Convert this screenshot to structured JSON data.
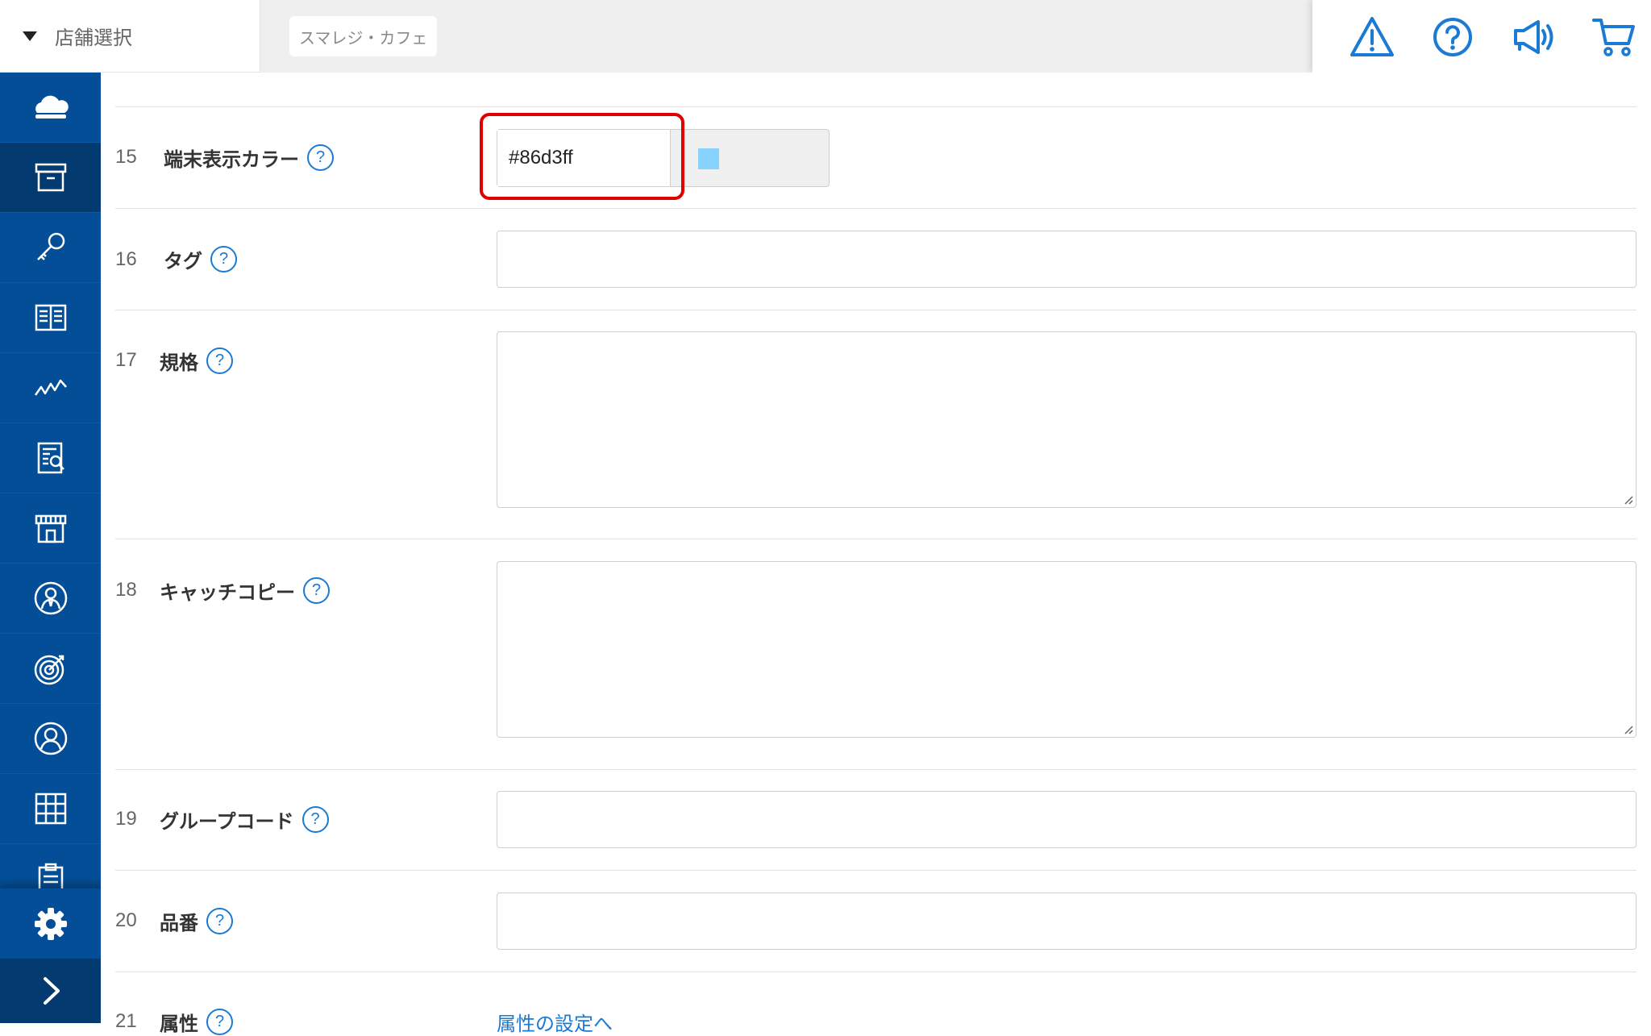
{
  "header": {
    "store_select_label": "店舗選択",
    "store_chip": "スマレジ・カフェ",
    "icons": [
      "warning-icon",
      "help-icon",
      "announcement-icon",
      "cart-icon"
    ]
  },
  "sidebar": {
    "items": [
      "cloud-icon",
      "archive-box-icon",
      "key-icon",
      "book-icon",
      "analytics-icon",
      "report-icon",
      "store-icon",
      "staff-icon",
      "target-icon",
      "customer-icon",
      "grid-icon",
      "clipboard-icon"
    ],
    "settings": "gear-icon",
    "expand": "chevron-right-icon"
  },
  "form": {
    "rows": [
      {
        "num": "15",
        "label": "端末表示カラー",
        "value": "#86d3ff",
        "swatch_color": "#86d3ff"
      },
      {
        "num": "16",
        "label": "タグ",
        "value": ""
      },
      {
        "num": "17",
        "label": "規格",
        "value": ""
      },
      {
        "num": "18",
        "label": "キャッチコピー",
        "value": ""
      },
      {
        "num": "19",
        "label": "グループコード",
        "value": ""
      },
      {
        "num": "20",
        "label": "品番",
        "value": ""
      },
      {
        "num": "21",
        "label": "属性",
        "link": "属性の設定へ"
      }
    ],
    "help_glyph": "?"
  },
  "colors": {
    "sidebar": "#034e96",
    "accent": "#1a7ad4",
    "highlight": "#e00000"
  }
}
